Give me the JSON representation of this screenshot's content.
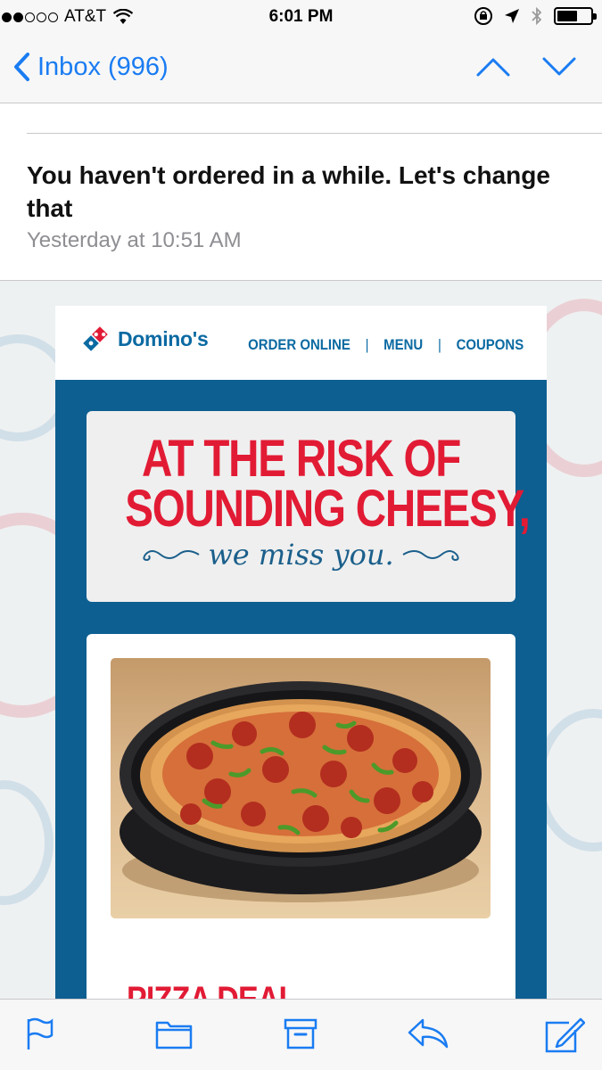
{
  "status_bar": {
    "carrier": "AT&T",
    "time": "6:01 PM",
    "signal_bars": 2,
    "signal_total": 5
  },
  "nav": {
    "back_label": "Inbox (996)"
  },
  "email": {
    "subject": "You haven't ordered in a while. Let's change that",
    "date": "Yesterday at 10:51 AM"
  },
  "dominos": {
    "logo_text": "Domino's",
    "menu": {
      "order_online": "ORDER ONLINE",
      "menu": "MENU",
      "coupons": "COUPONS",
      "separator": "|"
    },
    "banner": {
      "line1": "AT THE RISK OF",
      "line2": "SOUNDING CHEESY,",
      "script": "we miss you."
    },
    "deal_title": "PIZZA DEAL"
  },
  "colors": {
    "ios_blue": "#1a7cf2",
    "dominos_blue": "#0d5f91",
    "dominos_red": "#e21b35"
  },
  "toolbar": {
    "icons": [
      "flag-icon",
      "folder-icon",
      "archive-icon",
      "reply-icon",
      "compose-icon"
    ]
  }
}
